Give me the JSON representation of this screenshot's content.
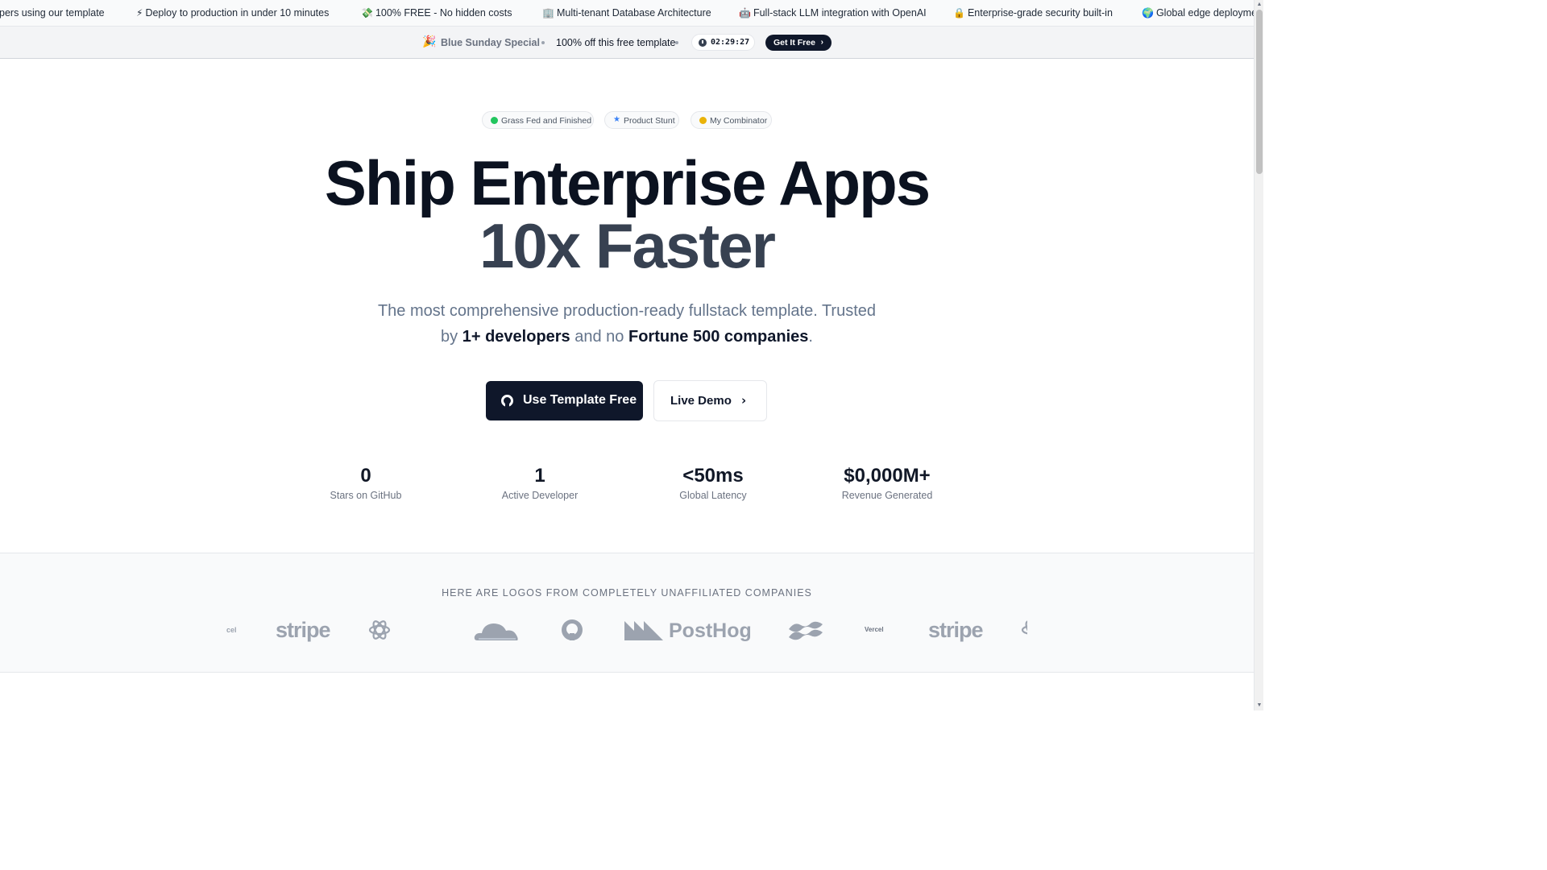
{
  "ticker": {
    "items": [
      {
        "emoji": "",
        "text": "pers using our template"
      },
      {
        "emoji": "⚡",
        "text": "Deploy to production in under 10 minutes"
      },
      {
        "emoji": "💸",
        "text": "100% FREE - No hidden costs"
      },
      {
        "emoji": "🏢",
        "text": "Multi-tenant Database Architecture"
      },
      {
        "emoji": "🤖",
        "text": "Full-stack LLM integration with OpenAI"
      },
      {
        "emoji": "🔒",
        "text": "Enterprise-grade security built-in"
      },
      {
        "emoji": "🌍",
        "text": "Global edge deploymen"
      }
    ]
  },
  "promo": {
    "emoji": "🎉",
    "title": "Blue Sunday Special",
    "text": "100% off this free template",
    "timer": "02:29:27",
    "cta": "Get It Free"
  },
  "badges": [
    "Grass Fed and Finished",
    "Product Stunt",
    "My Combinator"
  ],
  "hero": {
    "headline_line1": "Ship Enterprise Apps",
    "headline_line2": "10x Faster",
    "sub_part1": "The most comprehensive production-ready fullstack template. Trusted by ",
    "sub_bold1": "1+ developers",
    "sub_part2": " and no ",
    "sub_bold2": "Fortune 500 companies",
    "sub_part3": ".",
    "primary_cta": "Use Template Free",
    "secondary_cta": "Live Demo"
  },
  "stats": [
    {
      "value": "0",
      "label": "Stars on GitHub"
    },
    {
      "value": "1",
      "label": "Active Developer"
    },
    {
      "value": "<50ms",
      "label": "Global Latency"
    },
    {
      "value": "$0,000M+",
      "label": "Revenue Generated"
    }
  ],
  "logos": {
    "title": "HERE ARE LOGOS FROM COMPLETELY UNAFFILIATED COMPANIES",
    "items": [
      {
        "name": "vercel",
        "text": "cel"
      },
      {
        "name": "stripe",
        "text": "stripe"
      },
      {
        "name": "openai",
        "text": ""
      },
      {
        "name": "cloudflare",
        "text": ""
      },
      {
        "name": "github",
        "text": ""
      },
      {
        "name": "posthog",
        "text": "PostHog"
      },
      {
        "name": "tailwind",
        "text": ""
      },
      {
        "name": "vercel",
        "text": "Vercel"
      },
      {
        "name": "stripe",
        "text": "stripe"
      },
      {
        "name": "openai",
        "text": ""
      }
    ]
  }
}
